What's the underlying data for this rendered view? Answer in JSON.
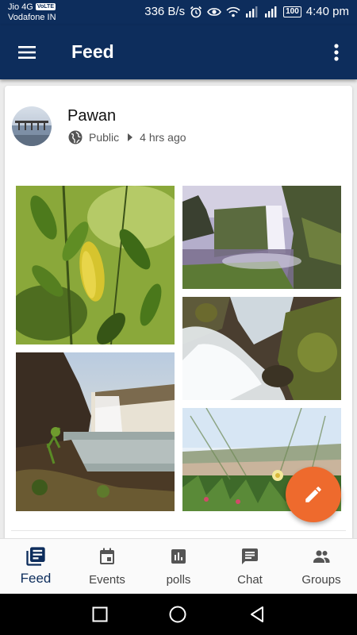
{
  "status_bar": {
    "carrier_line1": "Jio 4G",
    "volte_badge": "VoLTE",
    "carrier_line2": "Vodafone IN",
    "net_speed": "336 B/s",
    "battery": "100",
    "time": "4:40 pm"
  },
  "app_bar": {
    "title": "Feed",
    "menu_icon": "hamburger-menu-icon",
    "more_icon": "more-vert-icon"
  },
  "post": {
    "author": "Pawan",
    "visibility": "Public",
    "time_ago": "4 hrs ago",
    "photos": [
      "leaves",
      "waterfall-cliff",
      "cascade-rocks",
      "waterfall-river",
      "beach-flowers"
    ]
  },
  "fab": {
    "icon": "edit-pencil-icon",
    "color": "#ee6a2d"
  },
  "bottom_nav": {
    "items": [
      {
        "label": "Feed",
        "icon": "feed-icon",
        "active": true
      },
      {
        "label": "Events",
        "icon": "calendar-icon",
        "active": false
      },
      {
        "label": "polls",
        "icon": "poll-icon",
        "active": false
      },
      {
        "label": "Chat",
        "icon": "chat-icon",
        "active": false
      },
      {
        "label": "Groups",
        "icon": "groups-icon",
        "active": false
      }
    ]
  },
  "colors": {
    "primary": "#0d2d5c",
    "accent": "#ee6a2d"
  }
}
